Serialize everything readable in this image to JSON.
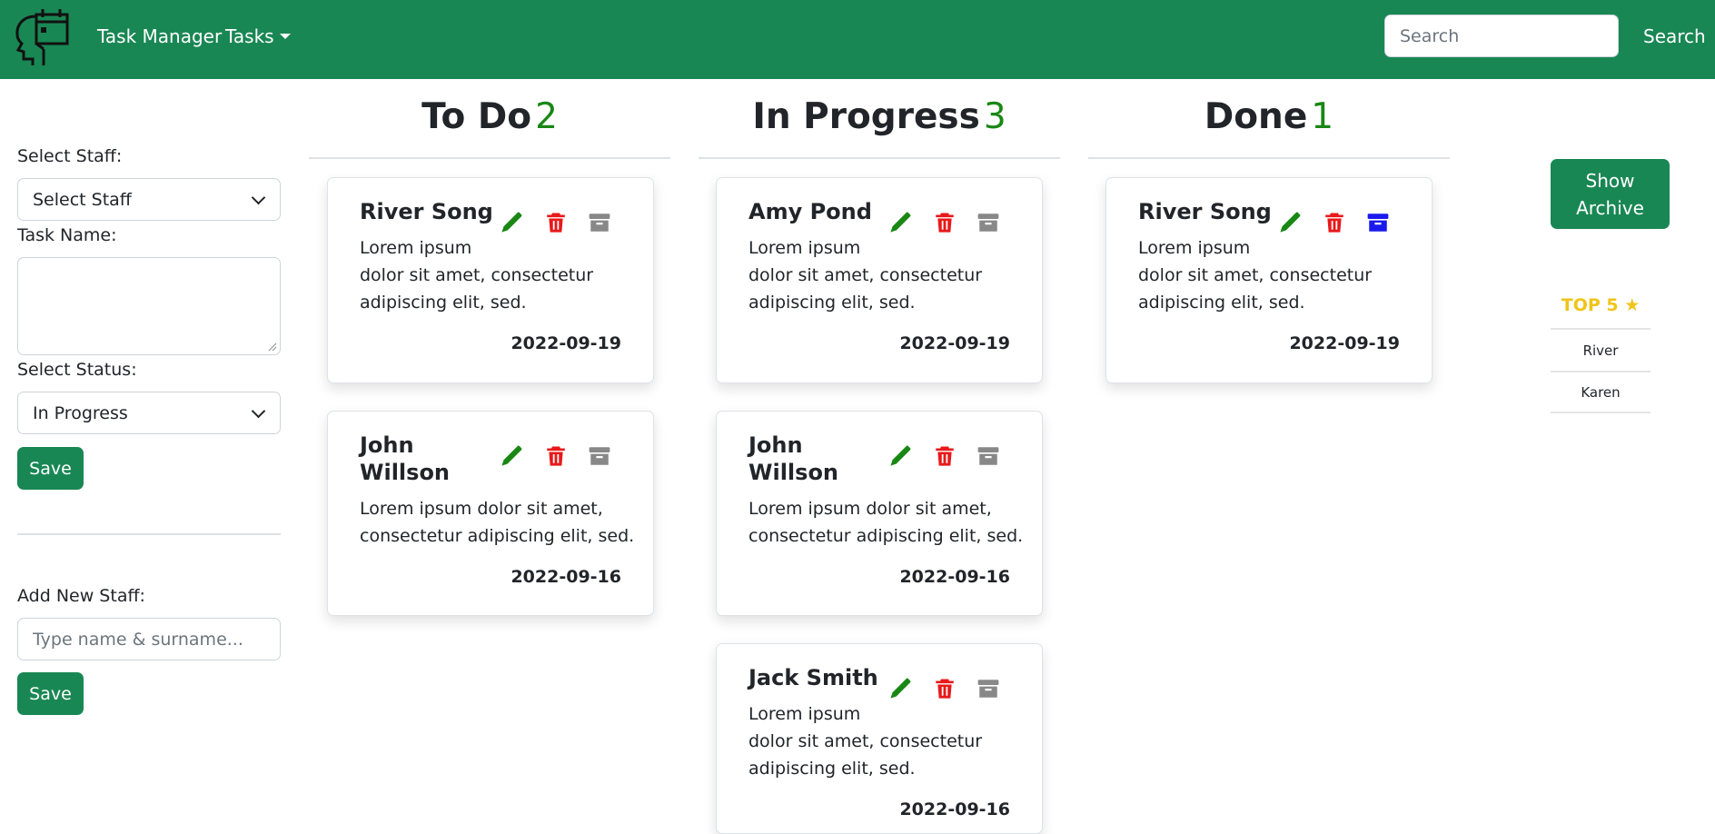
{
  "colors": {
    "brand": "#198754",
    "edit": "#198714",
    "delete": "#e8191a",
    "archive": "#888888",
    "archive_active": "#1a1aee",
    "top5": "#f0c419"
  },
  "navbar": {
    "brand": "Task Manager",
    "tasks_menu": "Tasks",
    "search_placeholder": "Search",
    "search_button": "Search"
  },
  "form": {
    "staff_label": "Select Staff:",
    "staff_value": "Select Staff",
    "task_label": "Task Name:",
    "task_value": "",
    "status_label": "Select Status:",
    "status_value": "In Progress",
    "save_label": "Save",
    "new_staff_label": "Add New Staff:",
    "new_staff_placeholder": "Type name & surname...",
    "new_staff_save": "Save"
  },
  "board": {
    "todo": {
      "title": "To Do",
      "count": "2",
      "cards": [
        {
          "name": "River Song",
          "text": [
            "Lorem ipsum",
            "dolor sit amet, consectetur",
            "adipiscing elit, sed."
          ],
          "date": "2022-09-19"
        },
        {
          "name": "John Willson",
          "text": [
            "Lorem ipsum dolor sit amet,",
            "consectetur adipiscing elit, sed."
          ],
          "date": "2022-09-16"
        }
      ]
    },
    "inprogress": {
      "title": "In Progress",
      "count": "3",
      "cards": [
        {
          "name": "Amy Pond",
          "text": [
            "Lorem ipsum",
            "dolor sit amet, consectetur",
            "adipiscing elit, sed."
          ],
          "date": "2022-09-19"
        },
        {
          "name": "John Willson",
          "text": [
            "Lorem ipsum dolor sit amet,",
            "consectetur adipiscing elit, sed."
          ],
          "date": "2022-09-16"
        },
        {
          "name": "Jack Smith",
          "text": [
            "Lorem ipsum",
            "dolor sit amet, consectetur",
            "adipiscing elit, sed."
          ],
          "date": "2022-09-16"
        }
      ]
    },
    "done": {
      "title": "Done",
      "count": "1",
      "cards": [
        {
          "name": "River Song",
          "text": [
            "Lorem ipsum",
            "dolor sit amet, consectetur",
            "adipiscing elit, sed."
          ],
          "date": "2022-09-19"
        }
      ]
    }
  },
  "sidebar": {
    "show_archive": "Show Archive",
    "top5_title": "TOP 5 ★",
    "top5": [
      "River",
      "Karen"
    ]
  }
}
